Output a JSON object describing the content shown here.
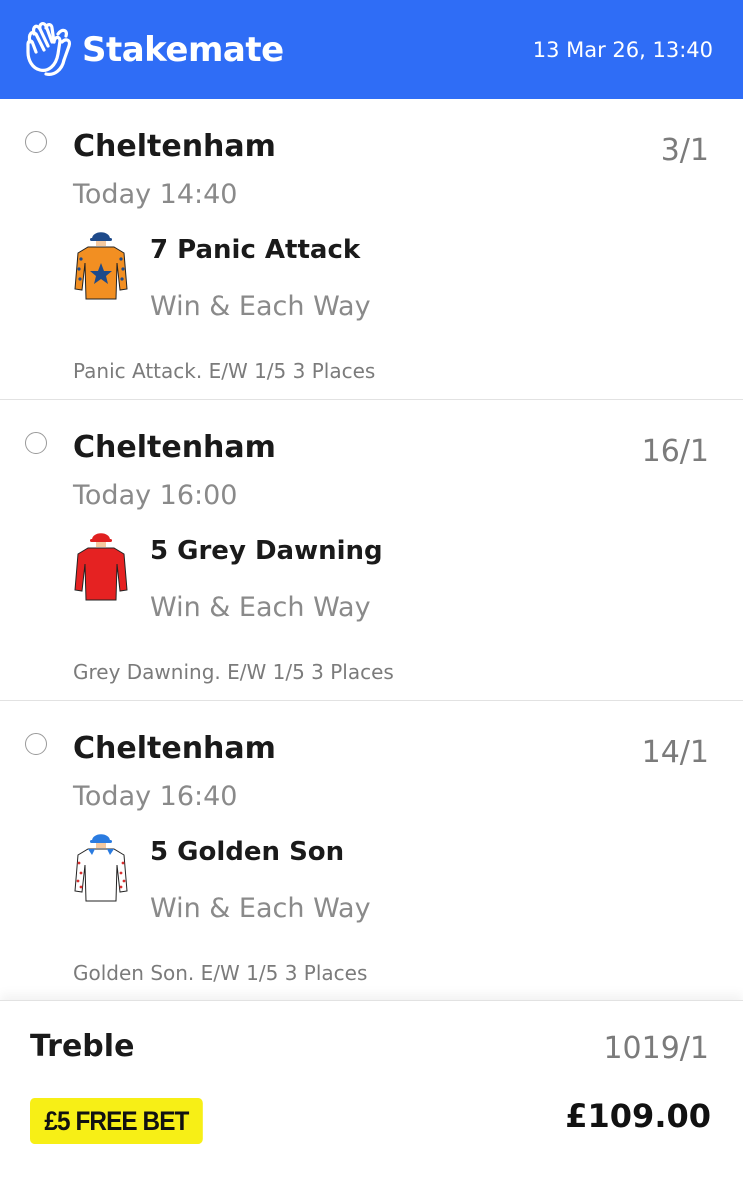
{
  "app": {
    "brand_name": "Stakemate",
    "datetime": "13 Mar 26, 13:40",
    "brand_color": "#2f6df6"
  },
  "selections": [
    {
      "venue": "Cheltenham",
      "time": "Today 14:40",
      "runner": "7 Panic Attack",
      "market": "Win & Each Way",
      "odds": "3/1",
      "terms": "Panic Attack. E/W 1/5 3 Places",
      "silk_icon": "orange-silk-blue-star-icon"
    },
    {
      "venue": "Cheltenham",
      "time": "Today 16:00",
      "runner": "5 Grey Dawning",
      "market": "Win & Each Way",
      "odds": "16/1",
      "terms": "Grey Dawning. E/W 1/5 3 Places",
      "silk_icon": "red-silk-icon"
    },
    {
      "venue": "Cheltenham",
      "time": "Today 16:40",
      "runner": "5 Golden Son",
      "market": "Win & Each Way",
      "odds": "14/1",
      "terms": "Golden Son. E/W 1/5 3 Places",
      "silk_icon": "white-silk-blue-cap-icon"
    }
  ],
  "bet": {
    "type": "Treble",
    "odds": "1019/1",
    "free_bet_label": "£5 FREE BET",
    "free_bet_color": "#f7ef16",
    "total": "£109.00"
  }
}
